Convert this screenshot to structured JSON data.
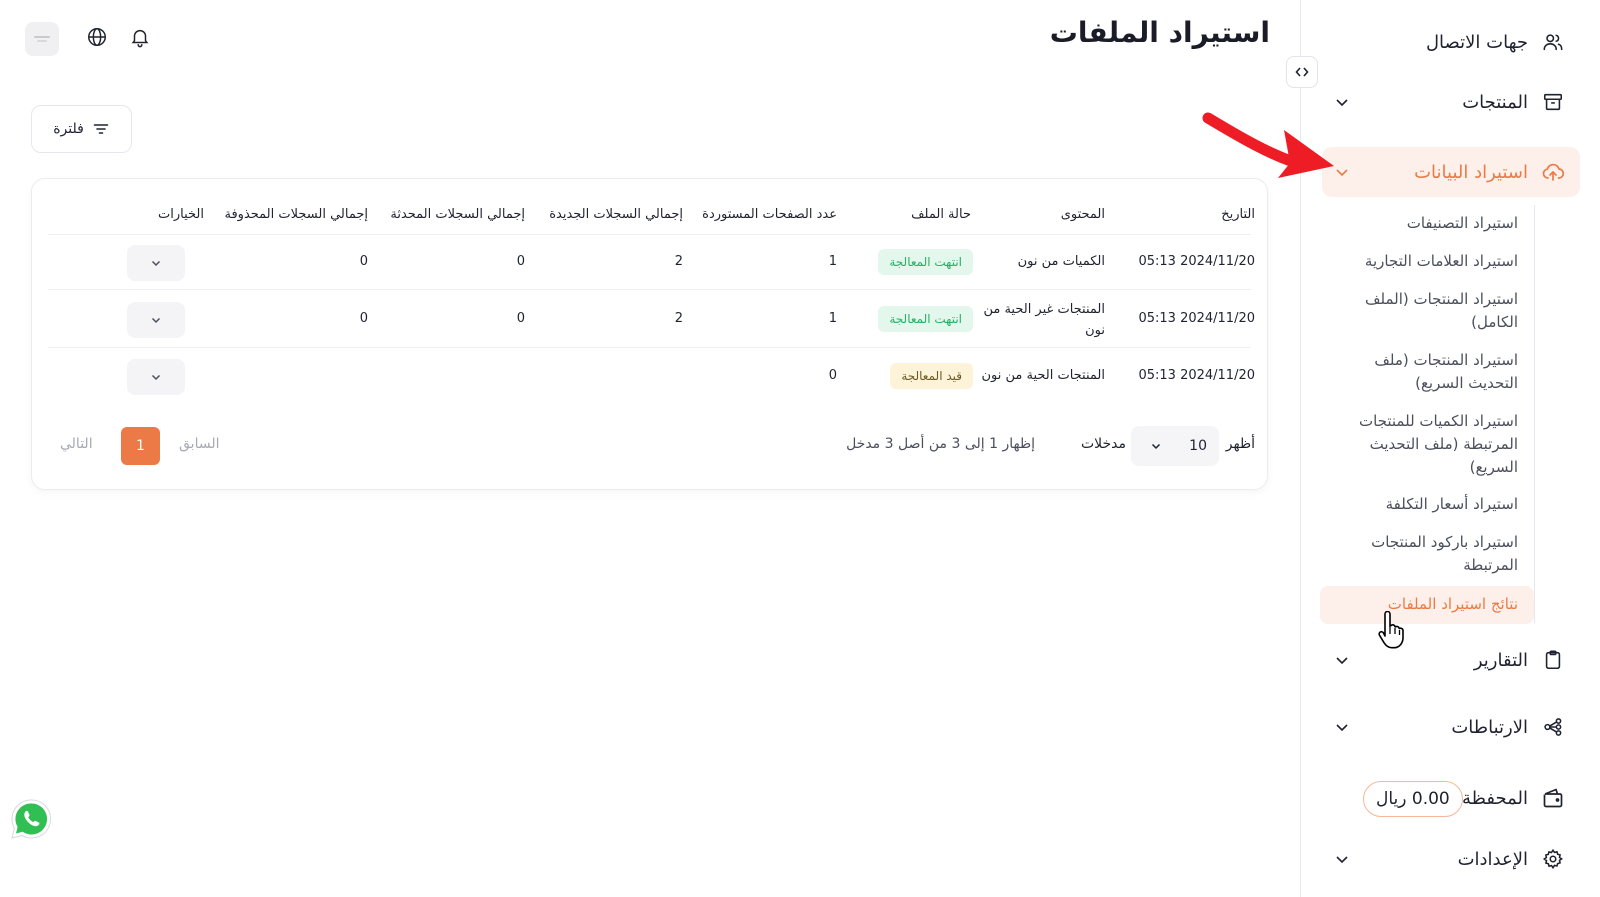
{
  "header": {
    "title": "استيراد الملفات"
  },
  "toolbar": {
    "filter_label": "فلترة"
  },
  "sidebar": {
    "items": [
      {
        "label": "جهات الاتصال",
        "icon": "users-icon"
      },
      {
        "label": "المنتجات",
        "icon": "archive-box-icon"
      },
      {
        "label": "استيراد البيانات",
        "icon": "cloud-upload-icon"
      },
      {
        "label": "التقارير",
        "icon": "clipboard-icon"
      },
      {
        "label": "الارتباطات",
        "icon": "share-nodes-icon"
      },
      {
        "label": "المحفظة",
        "icon": "wallet-icon"
      },
      {
        "label": "الإعدادات",
        "icon": "gear-icon"
      }
    ],
    "submenu": [
      "استيراد التصنيفات",
      "استيراد العلامات التجارية",
      "استيراد المنتجات (الملف الكامل)",
      "استيراد المنتجات (ملف التحديث السريع)",
      "استيراد الكميات للمنتجات المرتبطة (ملف التحديث السريع)",
      "استيراد أسعار التكلفة",
      "استيراد باركود المنتجات المرتبطة",
      "نتائج استيراد الملفات"
    ],
    "wallet_balance": "0.00 ريال"
  },
  "table": {
    "columns": [
      "التاريخ",
      "المحتوى",
      "حالة الملف",
      "عدد الصفحات المستوردة",
      "إجمالي السجلات الجديدة",
      "إجمالي السجلات المحدثة",
      "إجمالي السجلات المحذوفة",
      "الخيارات"
    ],
    "rows": [
      {
        "date": "2024/11/20 05:13",
        "content": "الكميات من نون",
        "status": "انتهت المعالجة",
        "pages": "1",
        "new": "2",
        "updated": "0",
        "deleted": "0"
      },
      {
        "date": "2024/11/20 05:13",
        "content": "المنتجات غير الحية من نون",
        "status": "انتهت المعالجة",
        "pages": "1",
        "new": "2",
        "updated": "0",
        "deleted": "0"
      },
      {
        "date": "2024/11/20 05:13",
        "content": "المنتجات الحية من نون",
        "status": "قيد المعالجة",
        "pages": "0",
        "new": "",
        "updated": "",
        "deleted": ""
      }
    ]
  },
  "pagination": {
    "show_label": "أظهر",
    "page_size": "10",
    "entries_label": "مدخلات",
    "summary": "إظهار 1 إلى 3 من أصل 3 مدخل",
    "prev_label": "السابق",
    "current_page": "1",
    "next_label": "التالي"
  },
  "colors": {
    "accent": "#ec7a46",
    "accent_bg": "#fdf0ea",
    "success_text": "#27b068",
    "success_bg": "#e4f7ec",
    "pending_bg": "#fdf3d9",
    "annotation_arrow": "#ee1c25"
  }
}
